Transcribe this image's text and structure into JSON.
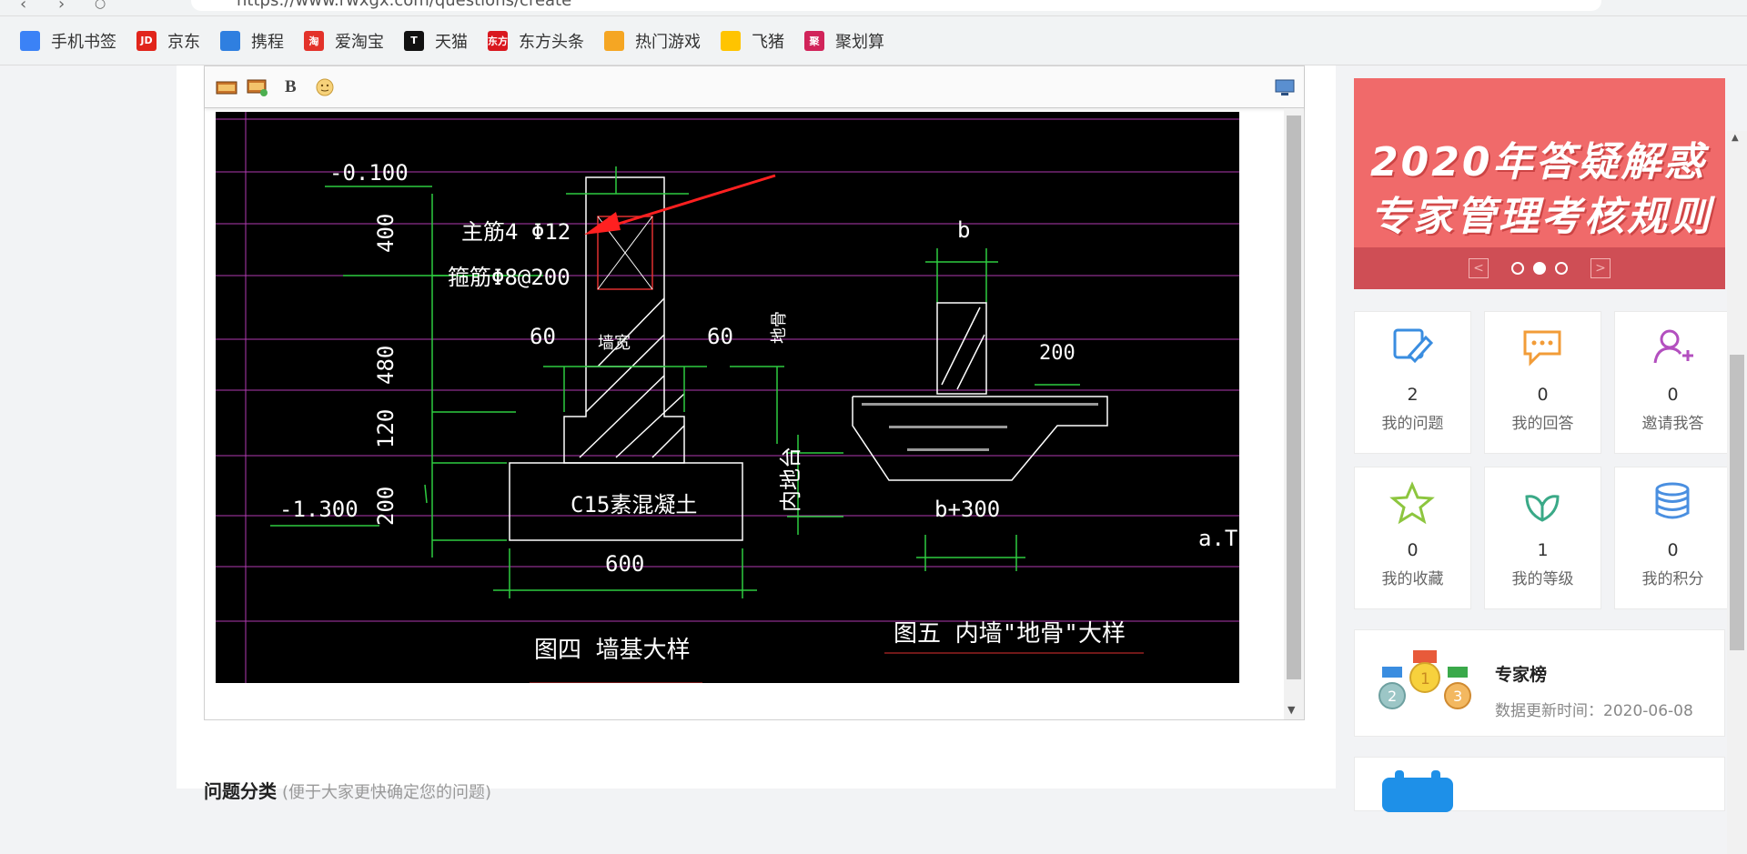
{
  "browser": {
    "url": "https://www.rwxgx.com/questions/create",
    "bookmarks": [
      {
        "label": "手机书签",
        "icon": "phone-bookmark-icon",
        "color": "#3b82f6",
        "glyph": ""
      },
      {
        "label": "京东",
        "icon": "jd-icon",
        "color": "#e1251b",
        "glyph": "JD"
      },
      {
        "label": "携程",
        "icon": "ctrip-icon",
        "color": "#2f7fe0",
        "glyph": ""
      },
      {
        "label": "爱淘宝",
        "icon": "taobao-icon",
        "color": "#e3322a",
        "glyph": "淘"
      },
      {
        "label": "天猫",
        "icon": "tmall-icon",
        "color": "#111111",
        "glyph": "T"
      },
      {
        "label": "东方头条",
        "icon": "dongfang-icon",
        "color": "#d9181f",
        "glyph": "东方"
      },
      {
        "label": "热门游戏",
        "icon": "game-icon",
        "color": "#f5a623",
        "glyph": ""
      },
      {
        "label": "飞猪",
        "icon": "fliggy-icon",
        "color": "#ffc400",
        "glyph": ""
      },
      {
        "label": "聚划算",
        "icon": "juhuasuan-icon",
        "color": "#d1245a",
        "glyph": "聚"
      }
    ]
  },
  "drawing": {
    "texts": [
      "-0.100",
      "主筋4 Φ12",
      "箍筋Φ8@200",
      "400",
      "480",
      "120",
      "200",
      "60",
      "60",
      "墙宽",
      "-1.300",
      "C15素混凝土",
      "600",
      "图四 墙基大样",
      "b",
      "地骨",
      "内地台",
      "200",
      "b+300",
      "图五 内墙\"地骨\"大样",
      "a.T"
    ]
  },
  "below_editor": {
    "label": "问题分类",
    "hint": "(便于大家更快确定您的问题)"
  },
  "banner": {
    "line1": "2020年答疑解惑",
    "line2": "专家管理考核规则",
    "prev": "<",
    "next": ">"
  },
  "stats": [
    {
      "value": "2",
      "label": "我的问题",
      "icon": "edit-note-icon",
      "color": "#3a8de0"
    },
    {
      "value": "0",
      "label": "我的回答",
      "icon": "chat-bubble-icon",
      "color": "#f29c38"
    },
    {
      "value": "0",
      "label": "邀请我答",
      "icon": "add-user-icon",
      "color": "#b34fbf"
    },
    {
      "value": "0",
      "label": "我的收藏",
      "icon": "star-icon",
      "color": "#8dc63f"
    },
    {
      "value": "1",
      "label": "我的等级",
      "icon": "leaf-icon",
      "color": "#3aa987"
    },
    {
      "value": "0",
      "label": "我的积分",
      "icon": "coins-icon",
      "color": "#4a8fe0"
    }
  ],
  "ranking": {
    "title": "专家榜",
    "updated": "数据更新时间：2020-06-08"
  }
}
